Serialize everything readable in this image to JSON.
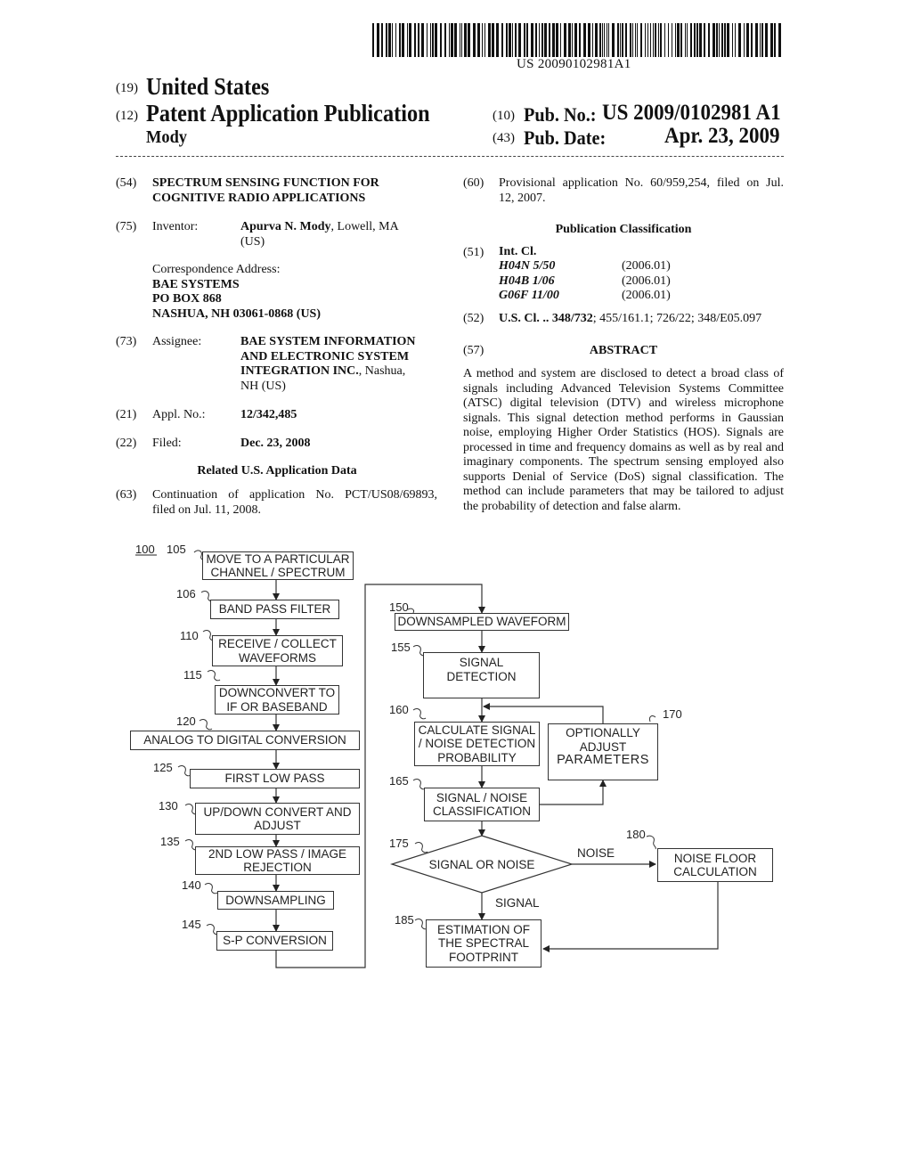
{
  "header": {
    "barcode_text": "US 20090102981A1",
    "country_code": "(19)",
    "country": "United States",
    "type_code": "(12)",
    "type": "Patent Application Publication",
    "inventor_surname": "Mody",
    "pub_no_code": "(10)",
    "pub_no_label": "Pub. No.:",
    "pub_no": "US 2009/0102981 A1",
    "pub_date_code": "(43)",
    "pub_date_label": "Pub. Date:",
    "pub_date": "Apr. 23, 2009"
  },
  "left": {
    "title_code": "(54)",
    "title_line1": "SPECTRUM SENSING FUNCTION FOR",
    "title_line2": "COGNITIVE RADIO APPLICATIONS",
    "inventor_code": "(75)",
    "inventor_label": "Inventor:",
    "inventor_name": "Apurva N. Mody",
    "inventor_loc": ", Lowell, MA",
    "inventor_loc2": "(US)",
    "corr_label": "Correspondence Address:",
    "corr_line1": "BAE SYSTEMS",
    "corr_line2": "PO BOX 868",
    "corr_line3": "NASHUA, NH 03061-0868 (US)",
    "assignee_code": "(73)",
    "assignee_label": "Assignee:",
    "assignee_line1": "BAE SYSTEM INFORMATION",
    "assignee_line2": "AND ELECTRONIC SYSTEM",
    "assignee_line3_bold": "INTEGRATION INC.",
    "assignee_line3_rest": ", Nashua,",
    "assignee_line4": "NH (US)",
    "appl_code": "(21)",
    "appl_label": "Appl. No.:",
    "appl_no": "12/342,485",
    "filed_code": "(22)",
    "filed_label": "Filed:",
    "filed_date": "Dec. 23, 2008",
    "related_heading": "Related U.S. Application Data",
    "cont_code": "(63)",
    "cont_line1": "Continuation of application No. PCT/US08/69893,",
    "cont_line2": "filed on Jul. 11, 2008."
  },
  "right": {
    "prov_code": "(60)",
    "prov_line1": "Provisional application No. 60/959,254, filed on Jul.",
    "prov_line2": "12, 2007.",
    "pubclass_heading": "Publication Classification",
    "intcl_code": "(51)",
    "intcl_label": "Int. Cl.",
    "intcl": [
      {
        "cls": "H04N 5/50",
        "ver": "(2006.01)"
      },
      {
        "cls": "H04B 1/06",
        "ver": "(2006.01)"
      },
      {
        "cls": "G06F 11/00",
        "ver": "(2006.01)"
      }
    ],
    "uscl_code": "(52)",
    "uscl_label": "U.S. Cl. ..",
    "uscl_main": "348/732",
    "uscl_rest": "; 455/161.1; 726/22; 348/E05.097",
    "abstract_code": "(57)",
    "abstract_heading": "ABSTRACT",
    "abstract_text": "A method and system are disclosed to detect a broad class of signals including Advanced Television Systems Committee (ATSC) digital television (DTV) and wireless microphone signals. This signal detection method performs in Gaussian noise, employing Higher Order Statistics (HOS). Signals are processed in time and frequency domains as well as by real and imaginary components. The spectrum sensing employed also supports Denial of Service (DoS) signal classification. The method can include parameters that may be tailored to adjust the probability of detection and false alarm."
  },
  "figure": {
    "fig_ref": "100",
    "steps": {
      "s105": {
        "ref": "105",
        "l1": "MOVE TO A PARTICULAR",
        "l2": "CHANNEL / SPECTRUM"
      },
      "s106": {
        "ref": "106",
        "l1": "BAND PASS FILTER"
      },
      "s110": {
        "ref": "110",
        "l1": "RECEIVE / COLLECT",
        "l2": "WAVEFORMS"
      },
      "s115": {
        "ref": "115",
        "l1": "DOWNCONVERT TO",
        "l2": "IF OR BASEBAND"
      },
      "s120": {
        "ref": "120",
        "l1": "ANALOG TO DIGITAL CONVERSION"
      },
      "s125": {
        "ref": "125",
        "l1": "FIRST LOW PASS"
      },
      "s130": {
        "ref": "130",
        "l1": "UP/DOWN CONVERT AND",
        "l2": "ADJUST"
      },
      "s135": {
        "ref": "135",
        "l1": "2ND LOW PASS / IMAGE",
        "l2": "REJECTION"
      },
      "s140": {
        "ref": "140",
        "l1": "DOWNSAMPLING"
      },
      "s145": {
        "ref": "145",
        "l1": "S-P CONVERSION"
      },
      "s150": {
        "ref": "150",
        "l1": "DOWNSAMPLED WAVEFORM"
      },
      "s155": {
        "ref": "155",
        "l1": "SIGNAL",
        "l2": "DETECTION"
      },
      "s160": {
        "ref": "160",
        "l1": "CALCULATE SIGNAL",
        "l2": "/ NOISE DETECTION",
        "l3": "PROBABILITY"
      },
      "s165": {
        "ref": "165",
        "l1": "SIGNAL / NOISE",
        "l2": "CLASSIFICATION"
      },
      "s170": {
        "ref": "170",
        "l1": "OPTIONALLY",
        "l2": "ADJUST",
        "l3": "PARAMETERS"
      },
      "s175": {
        "ref": "175",
        "l1": "SIGNAL OR NOISE"
      },
      "s180": {
        "ref": "180",
        "l1": "NOISE FLOOR",
        "l2": "CALCULATION"
      },
      "s185": {
        "ref": "185",
        "l1": "ESTIMATION OF",
        "l2": "THE SPECTRAL",
        "l3": "FOOTPRINT"
      }
    },
    "edge_noise": "NOISE",
    "edge_signal": "SIGNAL"
  }
}
